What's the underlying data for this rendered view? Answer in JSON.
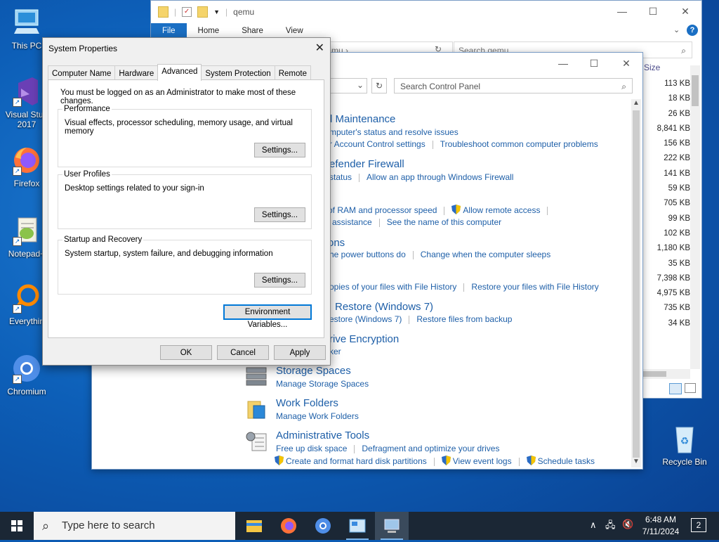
{
  "desktop": {
    "icons": [
      {
        "label": "This PC"
      },
      {
        "label": "Visual Stud 2017"
      },
      {
        "label": "Firefox"
      },
      {
        "label": "Notepad+"
      },
      {
        "label": "Everythin"
      },
      {
        "label": "Chromium"
      },
      {
        "label": "Recycle Bin"
      }
    ]
  },
  "explorer": {
    "title": "qemu",
    "ribbon_tabs": [
      "File",
      "Home",
      "Share",
      "View"
    ],
    "address": "mu",
    "search_placeholder": "Search qemu",
    "column_header": "Size",
    "sizes": [
      "113 KB",
      "18 KB",
      "26 KB",
      "8,841 KB",
      "156 KB",
      "222 KB",
      "141 KB",
      "59 KB",
      "705 KB",
      "99 KB",
      "102 KB",
      "1,180 KB",
      "35 KB",
      "7,398 KB",
      "4,975 KB",
      "735 KB",
      "34 KB"
    ]
  },
  "control_panel": {
    "search_placeholder": "Search Control Panel",
    "categories": [
      {
        "heading": "d Maintenance",
        "links": [
          "mputer's status and resolve issues"
        ],
        "links2": [
          "r Account Control settings",
          "Troubleshoot common computer problems"
        ]
      },
      {
        "heading": "efender Firewall",
        "links": [
          "status",
          "Allow an app through Windows Firewall"
        ]
      },
      {
        "heading": "",
        "links": [
          "of RAM and processor speed",
          "Allow remote access"
        ],
        "links2": [
          "assistance",
          "See the name of this computer"
        ]
      },
      {
        "heading": "ons",
        "links": [
          "he power buttons do",
          "Change when the computer sleeps"
        ]
      },
      {
        "heading": "",
        "links": [
          "opies of your files with File History",
          "Restore your files with File History"
        ]
      },
      {
        "heading": "Restore (Windows 7)",
        "links": [
          "estore (Windows 7)",
          "Restore files from backup"
        ]
      },
      {
        "heading": "rive Encryption",
        "links": [
          "ker"
        ]
      },
      {
        "heading": "Storage Spaces",
        "links": [
          "Manage Storage Spaces"
        ]
      },
      {
        "heading": "Work Folders",
        "links": [
          "Manage Work Folders"
        ]
      },
      {
        "heading": "Administrative Tools",
        "links": [
          "Free up disk space",
          "Defragment and optimize your drives"
        ],
        "links2": [
          "Create and format hard disk partitions",
          "View event logs",
          "Schedule tasks"
        ]
      }
    ]
  },
  "system_properties": {
    "title": "System Properties",
    "tabs": [
      "Computer Name",
      "Hardware",
      "Advanced",
      "System Protection",
      "Remote"
    ],
    "active_tab": "Advanced",
    "admin_note": "You must be logged on as an Administrator to make most of these changes.",
    "groups": [
      {
        "label": "Performance",
        "desc": "Visual effects, processor scheduling, memory usage, and virtual memory",
        "button": "Settings..."
      },
      {
        "label": "User Profiles",
        "desc": "Desktop settings related to your sign-in",
        "button": "Settings..."
      },
      {
        "label": "Startup and Recovery",
        "desc": "System startup, system failure, and debugging information",
        "button": "Settings..."
      }
    ],
    "env_button": "Environment Variables...",
    "ok": "OK",
    "cancel": "Cancel",
    "apply": "Apply"
  },
  "taskbar": {
    "search_placeholder": "Type here to search",
    "time": "6:48 AM",
    "date": "7/11/2024",
    "notification_count": "2"
  }
}
